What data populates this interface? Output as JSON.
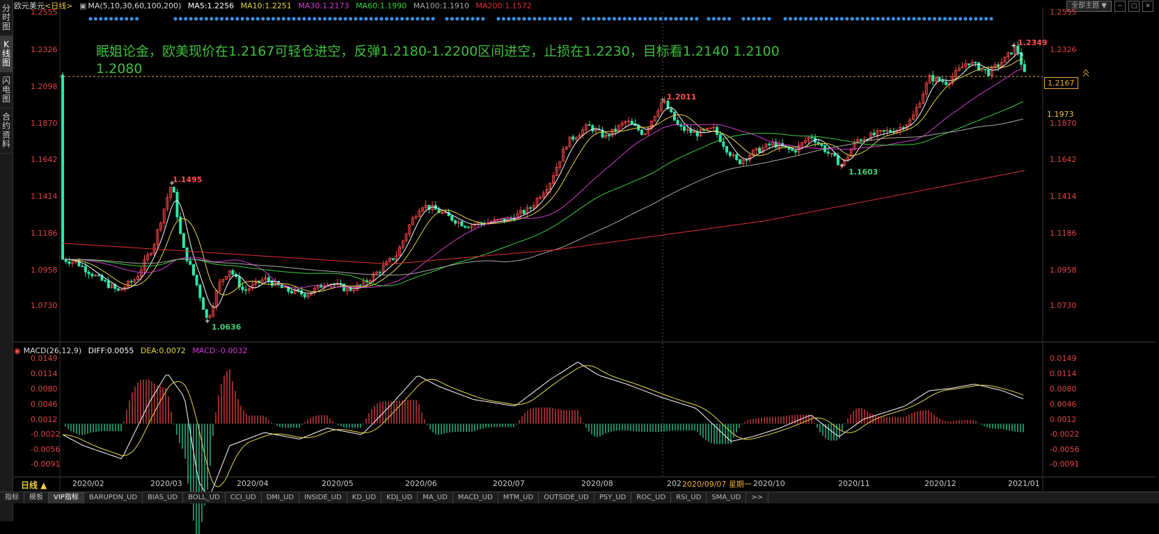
{
  "left_tabs": [
    {
      "label": "分时图",
      "active": false
    },
    {
      "label": "K线图",
      "active": true
    },
    {
      "label": "闪电图",
      "active": false
    },
    {
      "label": "合约资料",
      "active": false
    }
  ],
  "header": {
    "symbol": "欧元美元",
    "period": "<日线>",
    "ma_params": "MA(5,10,30,60,100,200)",
    "ma5": "MA5:1.2256",
    "ma10": "MA10:1.2251",
    "ma30": "MA30:1.2173",
    "ma60": "MA60:1.1990",
    "ma100": "MA100:1.1910",
    "ma200": "MA200:1.1572"
  },
  "toolbar": {
    "topic_select": "全部主题",
    "icons": [
      "dropdown-icon",
      "minimize-icon",
      "window-icon",
      "close-icon"
    ]
  },
  "annotation": {
    "line1": "眠姐论金，欧美现价在1.2167可轻仓进空，反弹1.2180-1.2200区间进空，止损在1.2230，目标看1.2140   1.2100",
    "line2": "1.2080"
  },
  "price_axis": {
    "labels": [
      "1.2555",
      "1.2326",
      "1.2098",
      "1.1870",
      "1.1642",
      "1.1414",
      "1.1186",
      "1.0958",
      "1.0730"
    ],
    "current_price_tag": "1.2167",
    "ma60_tag": "1.1973"
  },
  "extremes": {
    "high_mar": "1.1495",
    "low_mar": "1.0636",
    "high_sep": "1.2011",
    "low_nov": "1.1603",
    "high_jan": "1.2349"
  },
  "macd": {
    "params": "MACD(26,12,9)",
    "diff": "DIFF:0.0055",
    "dea": "DEA:0.0072",
    "macd": "MACD:-0.0032",
    "axis_labels": [
      "0.0149",
      "0.0114",
      "0.0080",
      "0.0046",
      "0.0012",
      "-0.0022",
      "-0.0056",
      "-0.0091"
    ]
  },
  "date_axis": {
    "labels": [
      "2020/02",
      "2020/03",
      "2020/04",
      "2020/05",
      "2020/06",
      "2020/07",
      "2020/08",
      "202",
      "2020/10",
      "2020/11",
      "2020/12",
      "2021/01"
    ],
    "cursor_date": "2020/09/07 星期一"
  },
  "period_button": "日线 ▲",
  "bottom_tabs": [
    "指标",
    "模板",
    "VIP指标",
    "BARUPDN_UD",
    "BIAS_UD",
    "BOLL_UD",
    "CCI_UD",
    "DMI_UD",
    "INSIDE_UD",
    "KD_UD",
    "KDJ_UD",
    "MA_UD",
    "MACD_UD",
    "MTM_UD",
    "OUTSIDE_UD",
    "PSY_UD",
    "ROC_UD",
    "RSI_UD",
    "SMA_UD",
    ">>"
  ],
  "bottom_tab_active": "VIP指标",
  "colors": {
    "up": "#ff4a4a",
    "down": "#2ee6a8",
    "ma5": "#ffffff",
    "ma10": "#e8d84a",
    "ma30": "#d23ad2",
    "ma60": "#3fcf3f",
    "ma100": "#aaaaaa",
    "ma200": "#e03030",
    "dea": "#e8d84a",
    "diff": "#ffffff"
  },
  "chart_data": {
    "type": "candlestick",
    "series_names": [
      "MA5",
      "MA10",
      "MA30",
      "MA60",
      "MA100",
      "MA200"
    ],
    "price_range": [
      1.0636,
      1.2555
    ],
    "x_range": [
      "2020/01",
      "2021/01"
    ],
    "key_points": [
      {
        "date": "2020/03",
        "label": "1.1495",
        "type": "high"
      },
      {
        "date": "2020/03",
        "label": "1.0636",
        "type": "low"
      },
      {
        "date": "2020/09",
        "label": "1.2011",
        "type": "high"
      },
      {
        "date": "2020/11",
        "label": "1.1603",
        "type": "low"
      },
      {
        "date": "2021/01",
        "label": "1.2349",
        "type": "high"
      }
    ],
    "macd_range": [
      -0.0091,
      0.0149
    ]
  }
}
